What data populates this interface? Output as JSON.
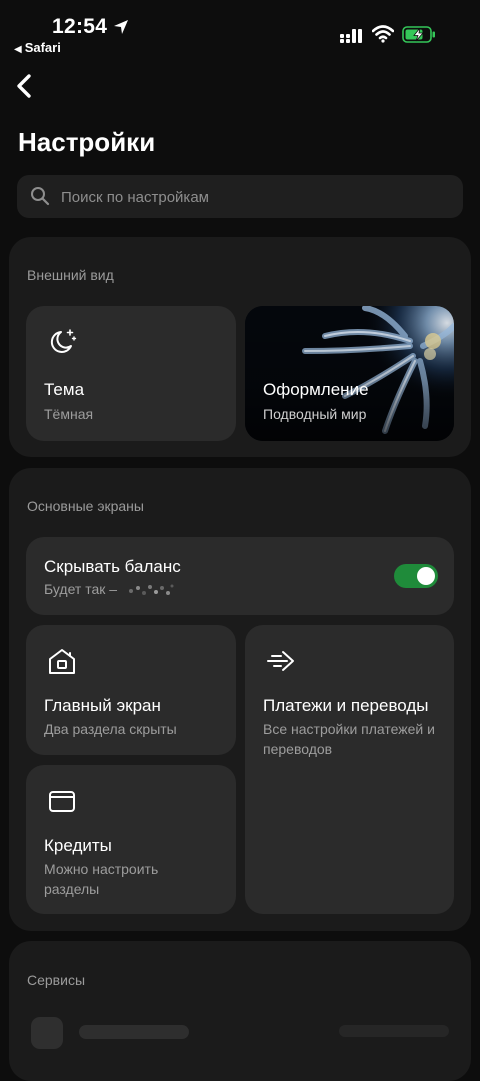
{
  "status_bar": {
    "time": "12:54",
    "back_app": "Safari",
    "icons": [
      "location-arrow-icon",
      "cellular-signal-icon",
      "wifi-icon",
      "battery-charging-icon"
    ]
  },
  "header": {
    "back_icon": "chevron-left-icon",
    "title": "Настройки"
  },
  "search": {
    "placeholder": "Поиск по настройкам",
    "value": ""
  },
  "appearance": {
    "section_title": "Внешний вид",
    "theme": {
      "icon": "moon-stars-icon",
      "title": "Тема",
      "subtitle": "Тёмная"
    },
    "design": {
      "title": "Оформление",
      "subtitle": "Подводный мир"
    }
  },
  "main_screens": {
    "section_title": "Основные экраны",
    "hide_balance": {
      "title": "Скрывать баланс",
      "subtitle": "Будет так –",
      "enabled": true
    },
    "home_screen": {
      "icon": "house-icon",
      "title": "Главный экран",
      "subtitle": "Два раздела скрыты"
    },
    "payments": {
      "icon": "arrow-right-motion-icon",
      "title": "Платежи и переводы",
      "subtitle": "Все настройки платежей и переводов"
    },
    "credits": {
      "icon": "wallet-icon",
      "title": "Кредиты",
      "subtitle": "Можно настроить разделы"
    }
  },
  "services": {
    "section_title": "Сервисы"
  },
  "colors": {
    "background": "#0d0d0d",
    "section": "#1b1b1b",
    "card": "#2b2b2b",
    "toggle_on": "#1f8b3a"
  }
}
